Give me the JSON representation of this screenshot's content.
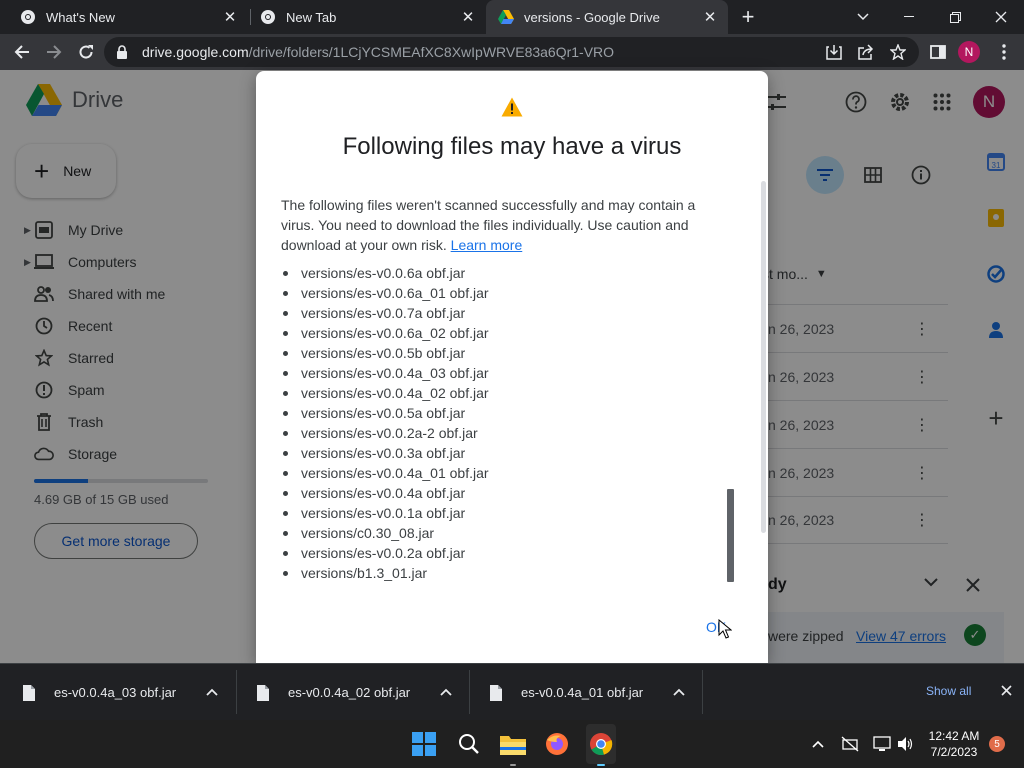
{
  "browser": {
    "tabs": [
      {
        "title": "What's New",
        "icon": "chrome-icon"
      },
      {
        "title": "New Tab",
        "icon": "chrome-icon"
      },
      {
        "title": "versions - Google Drive",
        "icon": "drive-icon",
        "active": true
      }
    ],
    "url_host": "drive.google.com",
    "url_path": "/drive/folders/1LCjYCSMEAfXC8XwIpWRVE83a6Qr1-VRO",
    "profile_initial": "N"
  },
  "drive": {
    "logo_text": "Drive",
    "new_label": "New",
    "nav": [
      {
        "label": "My Drive",
        "icon": "my-drive-icon",
        "expandable": true
      },
      {
        "label": "Computers",
        "icon": "computers-icon",
        "expandable": true
      },
      {
        "label": "Shared with me",
        "icon": "shared-icon"
      },
      {
        "label": "Recent",
        "icon": "clock-icon"
      },
      {
        "label": "Starred",
        "icon": "star-icon"
      },
      {
        "label": "Spam",
        "icon": "spam-icon"
      },
      {
        "label": "Trash",
        "icon": "trash-icon"
      },
      {
        "label": "Storage",
        "icon": "cloud-icon"
      }
    ],
    "storage_used_fraction": 0.313,
    "storage_text": "4.69 GB of 15 GB used",
    "get_storage_label": "Get more storage",
    "profile_initial": "N",
    "column_header": "st mo...",
    "rows": [
      {
        "date": "n 26, 2023"
      },
      {
        "date": "n 26, 2023"
      },
      {
        "date": "n 26, 2023"
      },
      {
        "date": "n 26, 2023"
      },
      {
        "date": "n 26, 2023"
      }
    ],
    "toast": {
      "title": "dy",
      "status": "were zipped",
      "errors_link": "View 47 errors"
    }
  },
  "dialog": {
    "title": "Following files may have a virus",
    "message": "The following files weren't scanned successfully and may contain a virus. You need to download the files individually. Use caution and download at your own risk.",
    "learn_more": "Learn more",
    "files": [
      "versions/es-v0.0.6a obf.jar",
      "versions/es-v0.0.6a_01 obf.jar",
      "versions/es-v0.0.7a obf.jar",
      "versions/es-v0.0.6a_02 obf.jar",
      "versions/es-v0.0.5b obf.jar",
      "versions/es-v0.0.4a_03 obf.jar",
      "versions/es-v0.0.4a_02 obf.jar",
      "versions/es-v0.0.5a obf.jar",
      "versions/es-v0.0.2a-2 obf.jar",
      "versions/es-v0.0.3a obf.jar",
      "versions/es-v0.0.4a_01 obf.jar",
      "versions/es-v0.0.4a obf.jar",
      "versions/es-v0.0.1a obf.jar",
      "versions/c0.30_08.jar",
      "versions/es-v0.0.2a obf.jar",
      "versions/b1.3_01.jar"
    ],
    "ok_label": "OK"
  },
  "downloads": {
    "items": [
      {
        "name": "es-v0.0.4a_03 obf.jar"
      },
      {
        "name": "es-v0.0.4a_02 obf.jar"
      },
      {
        "name": "es-v0.0.4a_01 obf.jar"
      }
    ],
    "show_all": "Show all"
  },
  "taskbar": {
    "time": "12:42 AM",
    "date": "7/2/2023",
    "notification_count": "5"
  },
  "colors": {
    "accent": "#1a73e8",
    "profile": "#b3175e",
    "warning": "#f9ab00",
    "success": "#188038"
  }
}
